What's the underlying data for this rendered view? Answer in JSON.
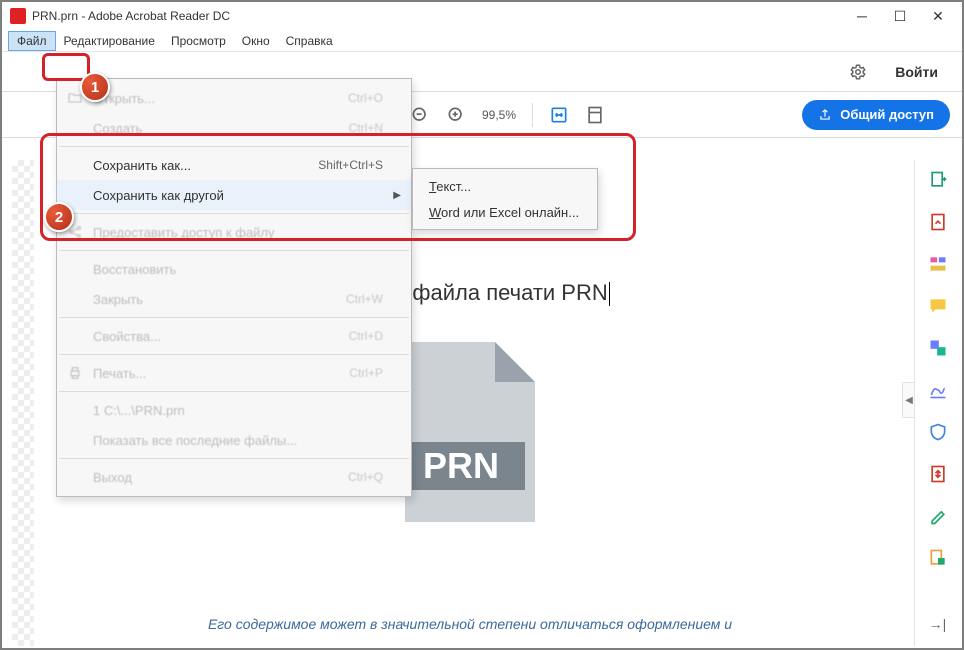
{
  "titlebar": {
    "title": "PRN.prn - Adobe Acrobat Reader DC"
  },
  "menubar": {
    "file": "Файл",
    "edit": "Редактирование",
    "view": "Просмотр",
    "window": "Окно",
    "help": "Справка"
  },
  "topright": {
    "login": "Войти"
  },
  "toolbar": {
    "zoom": "99,5%",
    "share": "Общий доступ"
  },
  "fileMenu": {
    "open": {
      "label": "Открыть...",
      "shortcut": "Ctrl+O"
    },
    "create": {
      "label": "Создать",
      "shortcut": "Ctrl+N"
    },
    "saveAs": {
      "label": "Сохранить как...",
      "shortcut": "Shift+Ctrl+S"
    },
    "saveAsOther": {
      "label": "Сохранить как другой"
    },
    "shareFile": {
      "label": "Предоставить доступ к файлу"
    },
    "revert": {
      "label": "Восстановить"
    },
    "close": {
      "label": "Закрыть",
      "shortcut": "Ctrl+W"
    },
    "properties": {
      "label": "Свойства...",
      "shortcut": "Ctrl+D"
    },
    "print": {
      "label": "Печать...",
      "shortcut": "Ctrl+P"
    },
    "recentCol": {
      "label": "1 C:\\...\\PRN.prn"
    },
    "showRecent": {
      "label": "Показать все последние файлы..."
    },
    "exit": {
      "label": "Выход",
      "shortcut": "Ctrl+Q"
    }
  },
  "submenu": {
    "text": "екст...",
    "textU": "Т",
    "wordExcel": "ord или Excel онлайн...",
    "wordExcelU": "W"
  },
  "document": {
    "heading": " пример файла печати PRN",
    "prnLabel": "PRN",
    "footer": "Его содержимое может в значительной степени отличаться оформлением и"
  },
  "markers": {
    "one": "1",
    "two": "2"
  }
}
